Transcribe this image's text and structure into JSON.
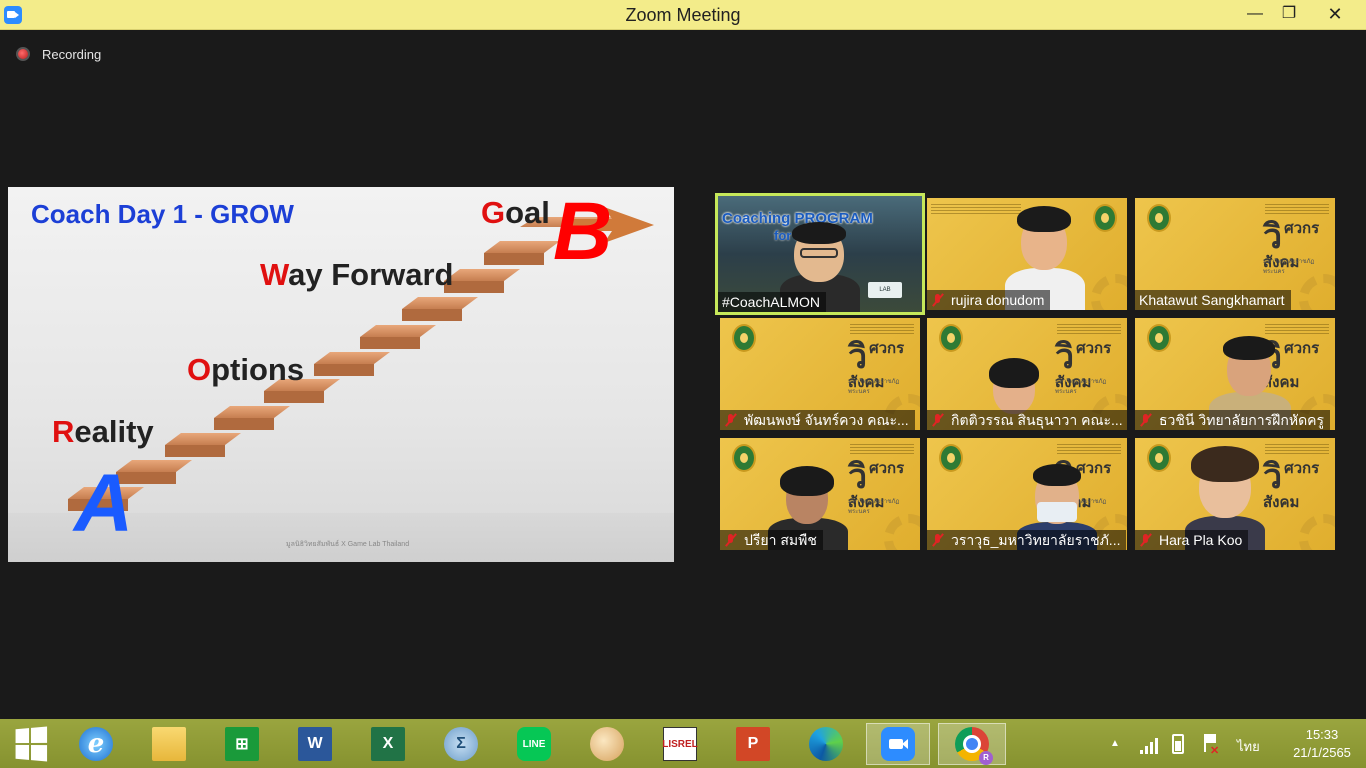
{
  "window": {
    "title": "Zoom Meeting",
    "minimize": "—",
    "maximize": "❐",
    "close": "✕"
  },
  "recording": {
    "label": "Recording"
  },
  "slide": {
    "title": "Coach Day 1 - GROW",
    "goal_cap": "G",
    "goal_rest": "oal",
    "way_cap": "W",
    "way_rest": "ay Forward",
    "options_cap": "O",
    "options_rest": "ptions",
    "reality_cap": "R",
    "reality_rest": "eality",
    "letter_b": "B",
    "letter_a": "A",
    "footer": "มูลนิธิวิทยสัมพันธ์ X Game Lab Thailand"
  },
  "participants": [
    {
      "name": "#CoachALMON",
      "muted": false,
      "active": true,
      "banner1": "Coaching PROGRAM",
      "banner2": "for lecturer"
    },
    {
      "name": "rujira donudom",
      "muted": true
    },
    {
      "name": "Khatawut Sangkhamart",
      "muted": false
    },
    {
      "name": "พัฒนพงษ์ จันทร์ควง คณะ...",
      "muted": true
    },
    {
      "name": "กิตติวรรณ สินธุนาวา คณะ...",
      "muted": true
    },
    {
      "name": "ธวชินี  วิทยาลัยการฝึกหัดครู",
      "muted": true
    },
    {
      "name": "ปรียา สมพืช",
      "muted": true
    },
    {
      "name": "วราวุธ_มหาวิทยาลัยราชภั...",
      "muted": true
    },
    {
      "name": "Hara Pla Koo",
      "muted": true
    }
  ],
  "tile_logo": {
    "line1": "ศวกร",
    "line2": "สังคม",
    "big": "วิ",
    "sub": "มหาวิทยาลัยราชภัฏพระนคร"
  },
  "taskbar": {
    "items": [
      "start",
      "internet-explorer",
      "file-explorer",
      "store",
      "word",
      "excel",
      "math-input",
      "line",
      "paint",
      "lisrel",
      "powerpoint",
      "edge",
      "zoom",
      "chrome"
    ],
    "word_label": "W",
    "excel_label": "X",
    "sigma_label": "Σ",
    "line_label": "LINE",
    "lisrel_label": "LISREL",
    "ppt_label": "P",
    "ie_label": "e",
    "chrome_badge": "R"
  },
  "tray": {
    "language": "ไทย",
    "time": "15:33",
    "date": "21/1/2565",
    "arrow": "▲",
    "flag_x": "✕"
  },
  "colors": {
    "titlebar": "#f3ec8a",
    "taskbar": "#8d9a3a",
    "slide_title": "#1c3fd6",
    "step_cap": "#e01010",
    "tile": "#e2b538",
    "active_border": "#c6e85a"
  }
}
